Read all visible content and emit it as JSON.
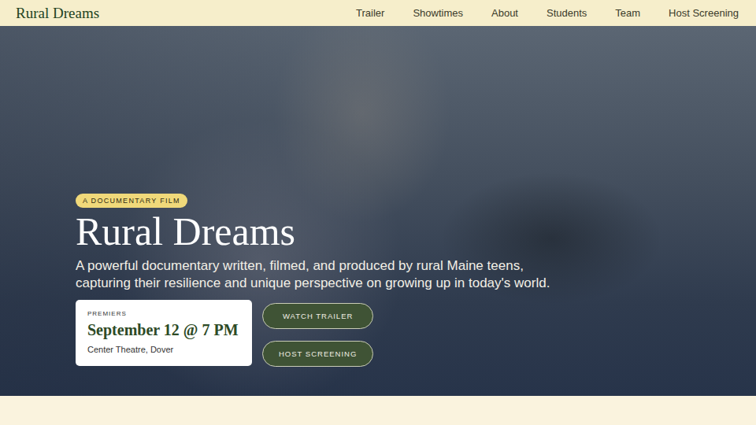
{
  "logo": "Rural Dreams",
  "nav": [
    "Trailer",
    "Showtimes",
    "About",
    "Students",
    "Team",
    "Host Screening"
  ],
  "hero": {
    "badge": "A DOCUMENTARY FILM",
    "title": "Rural Dreams",
    "subtitle": "A powerful documentary written, filmed, and produced by rural Maine teens, capturing their resilience and unique perspective on growing up in today's world.",
    "premiere": {
      "label": "PREMIERS",
      "date": "September 12 @ 7 PM",
      "venue": "Center Theatre, Dover"
    },
    "buttons": [
      "WATCH TRAILER",
      "HOST SCREENING"
    ]
  }
}
